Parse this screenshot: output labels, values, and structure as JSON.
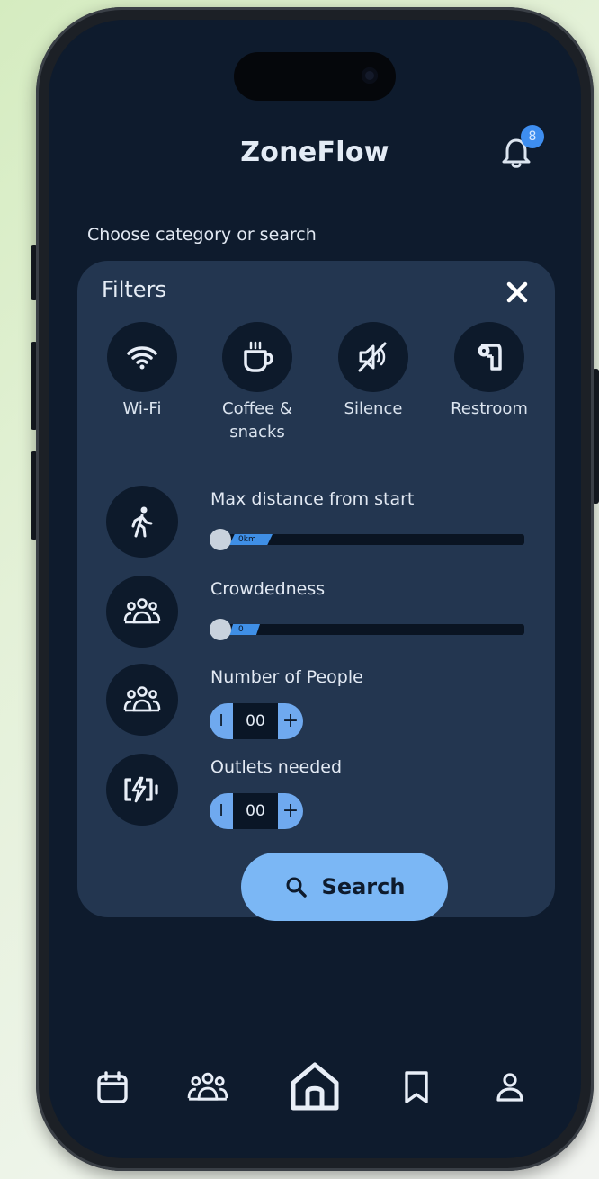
{
  "app": {
    "title": "ZoneFlow",
    "notification_count": "8"
  },
  "prompt": "Choose category or search",
  "filters": {
    "title": "Filters",
    "categories": [
      {
        "label": "Wi-Fi",
        "icon": "wifi-icon"
      },
      {
        "label": "Coffee &",
        "label2": "snacks",
        "icon": "coffee-icon"
      },
      {
        "label": "Silence",
        "icon": "mute-icon"
      },
      {
        "label": "Restroom",
        "icon": "toilet-paper-icon"
      }
    ],
    "max_distance": {
      "label": "Max distance from start",
      "value_text": "0km",
      "icon": "walking-icon"
    },
    "crowdedness": {
      "label": "Crowdedness",
      "value_text": "0",
      "icon": "people-group-icon"
    },
    "people": {
      "label": "Number of People",
      "value": "00",
      "minus": "I",
      "plus": "+",
      "icon": "people-group-icon"
    },
    "outlets": {
      "label": "Outlets needed",
      "value": "00",
      "minus": "I",
      "plus": "+",
      "icon": "battery-charging-icon"
    },
    "search_label": "Search"
  },
  "bottom_nav": [
    "calendar-icon",
    "people-group-icon",
    "home-icon",
    "bookmark-icon",
    "profile-icon"
  ],
  "colors": {
    "background": "#0e1b2d",
    "panel": "#233650",
    "accent": "#7bb7f5"
  }
}
